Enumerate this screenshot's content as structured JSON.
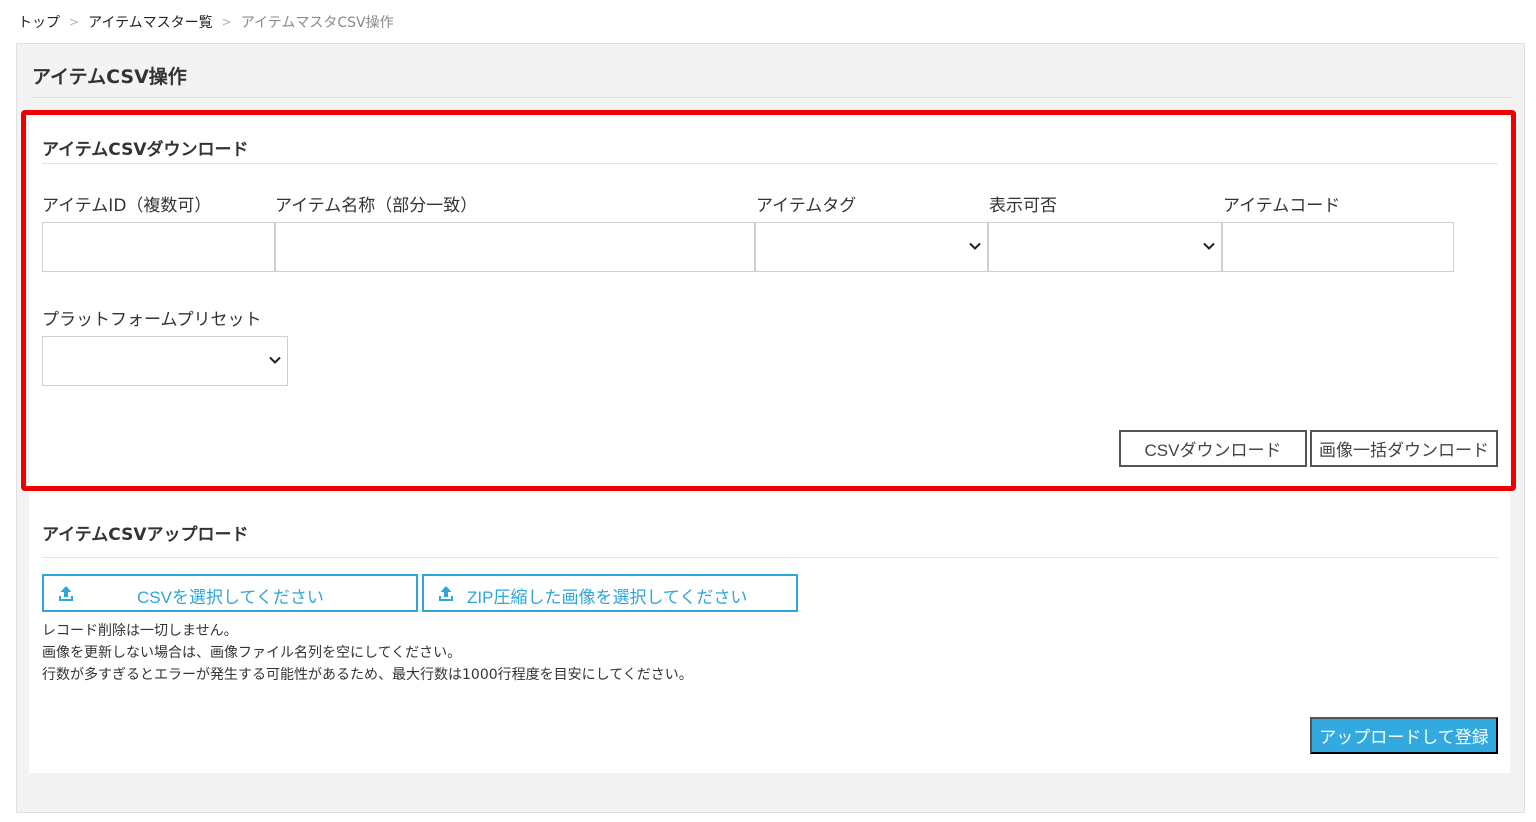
{
  "breadcrumb": {
    "items": [
      "トップ",
      "アイテムマスター覧",
      "アイテムマスタCSV操作"
    ],
    "separator": ">"
  },
  "page": {
    "title": "アイテムCSV操作"
  },
  "download": {
    "title": "アイテムCSVダウンロード",
    "fields": {
      "item_id": {
        "label": "アイテムID（複数可）",
        "value": ""
      },
      "item_name": {
        "label": "アイテム名称（部分一致）",
        "value": ""
      },
      "item_tag": {
        "label": "アイテムタグ",
        "selected": ""
      },
      "visibility": {
        "label": "表示可否",
        "selected": ""
      },
      "item_code": {
        "label": "アイテムコード",
        "value": ""
      },
      "platform_preset": {
        "label": "プラットフォームプリセット",
        "selected": ""
      }
    },
    "csv_button": "CSVダウンロード",
    "images_button": "画像一括ダウンロード"
  },
  "upload": {
    "title": "アイテムCSVアップロード",
    "csv_file_button": "CSVを選択してください",
    "zip_file_button": "ZIP圧縮した画像を選択してください",
    "notes": [
      "レコード削除は一切しません。",
      "画像を更新しない場合は、画像ファイル名列を空にしてください。",
      "行数が多すぎるとエラーが発生する可能性があるため、最大行数は1000行程度を目安にしてください。"
    ],
    "submit_button": "アップロードして登録"
  },
  "colors": {
    "accent": "#33aadf",
    "highlight": "#ee0000",
    "panel_bg": "#f3f3f3"
  },
  "icons": {
    "select_arrow": "chevron-down-icon",
    "upload": "upload-icon"
  }
}
